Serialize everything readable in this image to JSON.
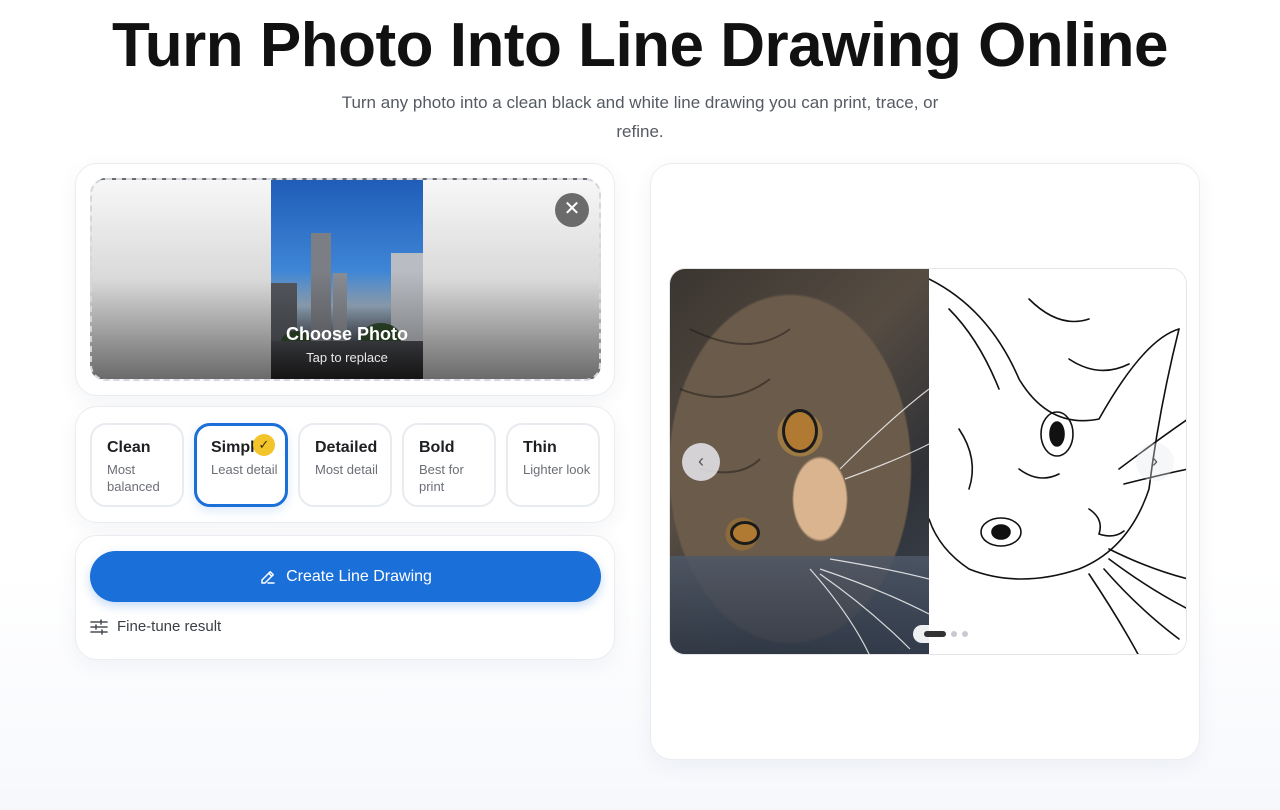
{
  "hero": {
    "title": "Turn Photo Into Line Drawing Online",
    "subtitle": "Turn any photo into a clean black and white line drawing you can print, trace, or refine."
  },
  "upload": {
    "choose_label": "Choose Photo",
    "replace_hint": "Tap to replace",
    "close_icon": "close-icon"
  },
  "styles": {
    "items": [
      {
        "name": "Clean",
        "desc": "Most balanced",
        "selected": false
      },
      {
        "name": "Simple",
        "desc": "Least detail",
        "selected": true
      },
      {
        "name": "Detailed",
        "desc": "Most detail",
        "selected": false
      },
      {
        "name": "Bold",
        "desc": "Best for print",
        "selected": false
      },
      {
        "name": "Thin",
        "desc": "Lighter look",
        "selected": false
      }
    ]
  },
  "actions": {
    "create_label": "Create Line Drawing",
    "finetune_label": "Fine-tune result"
  },
  "preview": {
    "prev_icon": "chevron-left-icon",
    "next_icon": "chevron-right-icon",
    "slide_count": 3,
    "active_slide": 1
  },
  "colors": {
    "accent": "#1a6fd8",
    "check_badge": "#f4c52a"
  }
}
